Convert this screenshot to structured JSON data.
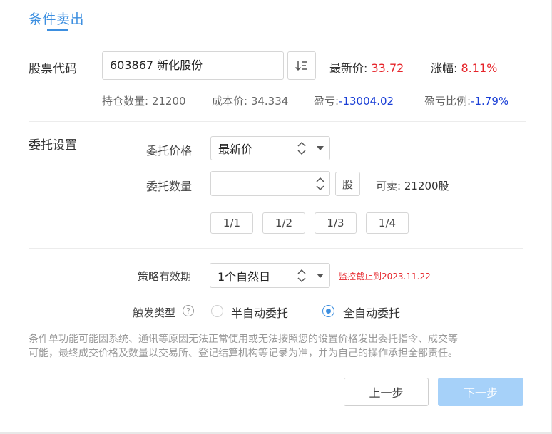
{
  "header": {
    "title": "条件卖出"
  },
  "stock": {
    "label": "股票代码",
    "code_value": "603867  新化股份",
    "latest_price_label": "最新价:",
    "latest_price": "33.72",
    "change_label": "涨幅:",
    "change": "8.11%"
  },
  "position": {
    "holding_qty": "持仓数量: 21200",
    "cost_price": "成本价: 34.334",
    "pl_label": "盈亏:",
    "pl_value": "-13004.02",
    "pl_ratio_label": "盈亏比例:",
    "pl_ratio_value": "-1.79%"
  },
  "order": {
    "section_label": "委托设置",
    "price_label": "委托价格",
    "price_select": "最新价",
    "qty_label": "委托数量",
    "qty_value": "",
    "qty_unit": "股",
    "sellable": "可卖: 21200股",
    "fractions": [
      "1/1",
      "1/2",
      "1/3",
      "1/4"
    ]
  },
  "strategy": {
    "validity_label": "策略有效期",
    "validity_select": "1个自然日",
    "monitor_until": "监控截止到2023.11.22",
    "trigger_label": "触发类型",
    "trigger_options": [
      "半自动委托",
      "全自动委托"
    ],
    "trigger_selected": "全自动委托"
  },
  "disclaimer": {
    "line1": "条件单功能可能因系统、通讯等原因无法正常使用或无法按照您的设置价格发出委托指令、成交等",
    "line2": "可能，最终成交价格及数量以交易所、登记结算机构等记录为准，并为自己的操作承担全部责任。"
  },
  "buttons": {
    "prev": "上一步",
    "next": "下一步"
  },
  "colors": {
    "accent": "#3d8fe0",
    "up_red": "#e6242a",
    "down_blue": "#1a3fd6",
    "disabled_next": "#a6d1f9"
  }
}
